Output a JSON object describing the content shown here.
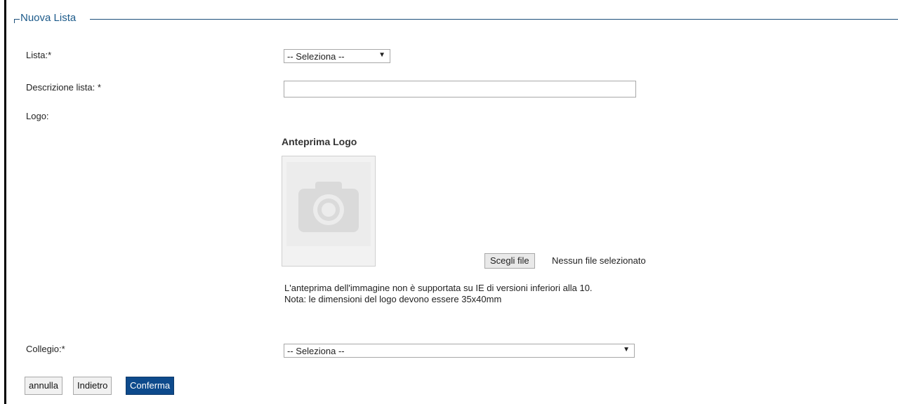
{
  "form": {
    "legend": "Nuova Lista",
    "lista_label": "Lista:*",
    "lista_select_value": "-- Seleziona --",
    "descrizione_label": "Descrizione lista: *",
    "descrizione_value": "",
    "logo_label": "Logo:",
    "collegio_label": "Collegio:*",
    "collegio_select_value": "-- Seleziona --"
  },
  "logo": {
    "preview_title": "Anteprima Logo",
    "choose_file_label": "Scegli file",
    "file_status": "Nessun file selezionato",
    "note_line1": "L'anteprima dell'immagine non è supportata su IE di versioni inferiori alla 10.",
    "note_line2": "Nota: le dimensioni del logo devono essere 35x40mm"
  },
  "buttons": {
    "annulla": "annulla",
    "indietro": "Indietro",
    "conferma": "Conferma"
  },
  "colors": {
    "legend": "#1c5a8a",
    "primary_button": "#0d4a8c"
  },
  "icons": {
    "dropdown": "chevron-down-icon",
    "preview_placeholder": "camera-icon"
  }
}
